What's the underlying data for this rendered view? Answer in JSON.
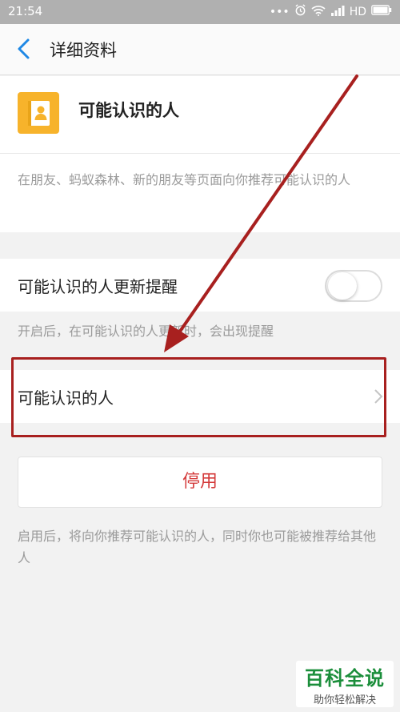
{
  "status_bar": {
    "time": "21:54",
    "network": "HD",
    "icons": [
      "more-dots-icon",
      "alarm-icon",
      "wifi-icon",
      "signal-icon",
      "battery-icon"
    ]
  },
  "navbar": {
    "title": "详细资料",
    "back_icon": "chevron-left-icon"
  },
  "profile": {
    "app_name": "可能认识的人",
    "icon_color": "#f7b32b",
    "description": "在朋友、蚂蚁森林、新的朋友等页面向你推荐可能认识的人"
  },
  "settings": {
    "update_reminder_label": "可能认识的人更新提醒",
    "update_reminder_on": false,
    "update_reminder_hint": "开启后，在可能认识的人更新时，会出现提醒",
    "people_label": "可能认识的人"
  },
  "disable_button": {
    "label": "停用",
    "color": "#d43b3b"
  },
  "footer_hint": "启用后，将向你推荐可能认识的人，同时你也可能被推荐给其他人",
  "annotation": {
    "color": "#a8201f"
  },
  "watermark": {
    "main": "百科全说",
    "sub": "助你轻松解决",
    "color": "#1b8e3b"
  }
}
